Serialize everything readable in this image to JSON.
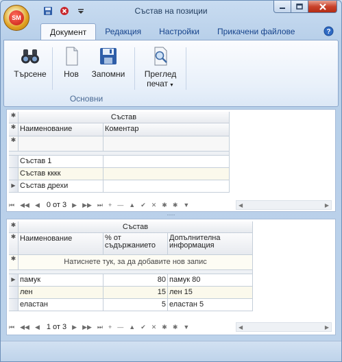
{
  "window": {
    "title": "Състав на позиции",
    "app_logo": "SM"
  },
  "ribbon": {
    "tabs": [
      "Документ",
      "Редакция",
      "Настройки",
      "Прикачени файлове"
    ],
    "active_tab": "Документ",
    "buttons": {
      "search": "Търсене",
      "new": "Нов",
      "save": "Запомни",
      "preview_line1": "Преглед",
      "preview_line2": "печат"
    },
    "group_label": "Основни"
  },
  "grid1": {
    "band": "Състав",
    "columns": [
      "Наименование",
      "Коментар"
    ],
    "rows": [
      {
        "name": "Състав 1",
        "comment": ""
      },
      {
        "name": "Състав кккк",
        "comment": ""
      },
      {
        "name": "Състав дрехи",
        "comment": ""
      }
    ],
    "selected_row": 2,
    "navigator": {
      "count": "0 от 3"
    }
  },
  "grid2": {
    "band": "Състав",
    "columns": [
      "Наименование",
      "% от съдържанието",
      "Допълнителна информация"
    ],
    "add_row_text": "Натиснете тук, за да добавите нов запис",
    "rows": [
      {
        "name": "памук",
        "percent": "80",
        "info": "памук 80"
      },
      {
        "name": "лен",
        "percent": "15",
        "info": "лен 15"
      },
      {
        "name": "еластан",
        "percent": "5",
        "info": "еластан 5"
      }
    ],
    "selected_row": 0,
    "navigator": {
      "count": "1 от 3"
    }
  },
  "colors": {
    "frame": "#bcd2ea",
    "ribbon": "#e8f0fa",
    "alt_row": "#fbf9ec",
    "close_button": "#c9432c"
  }
}
